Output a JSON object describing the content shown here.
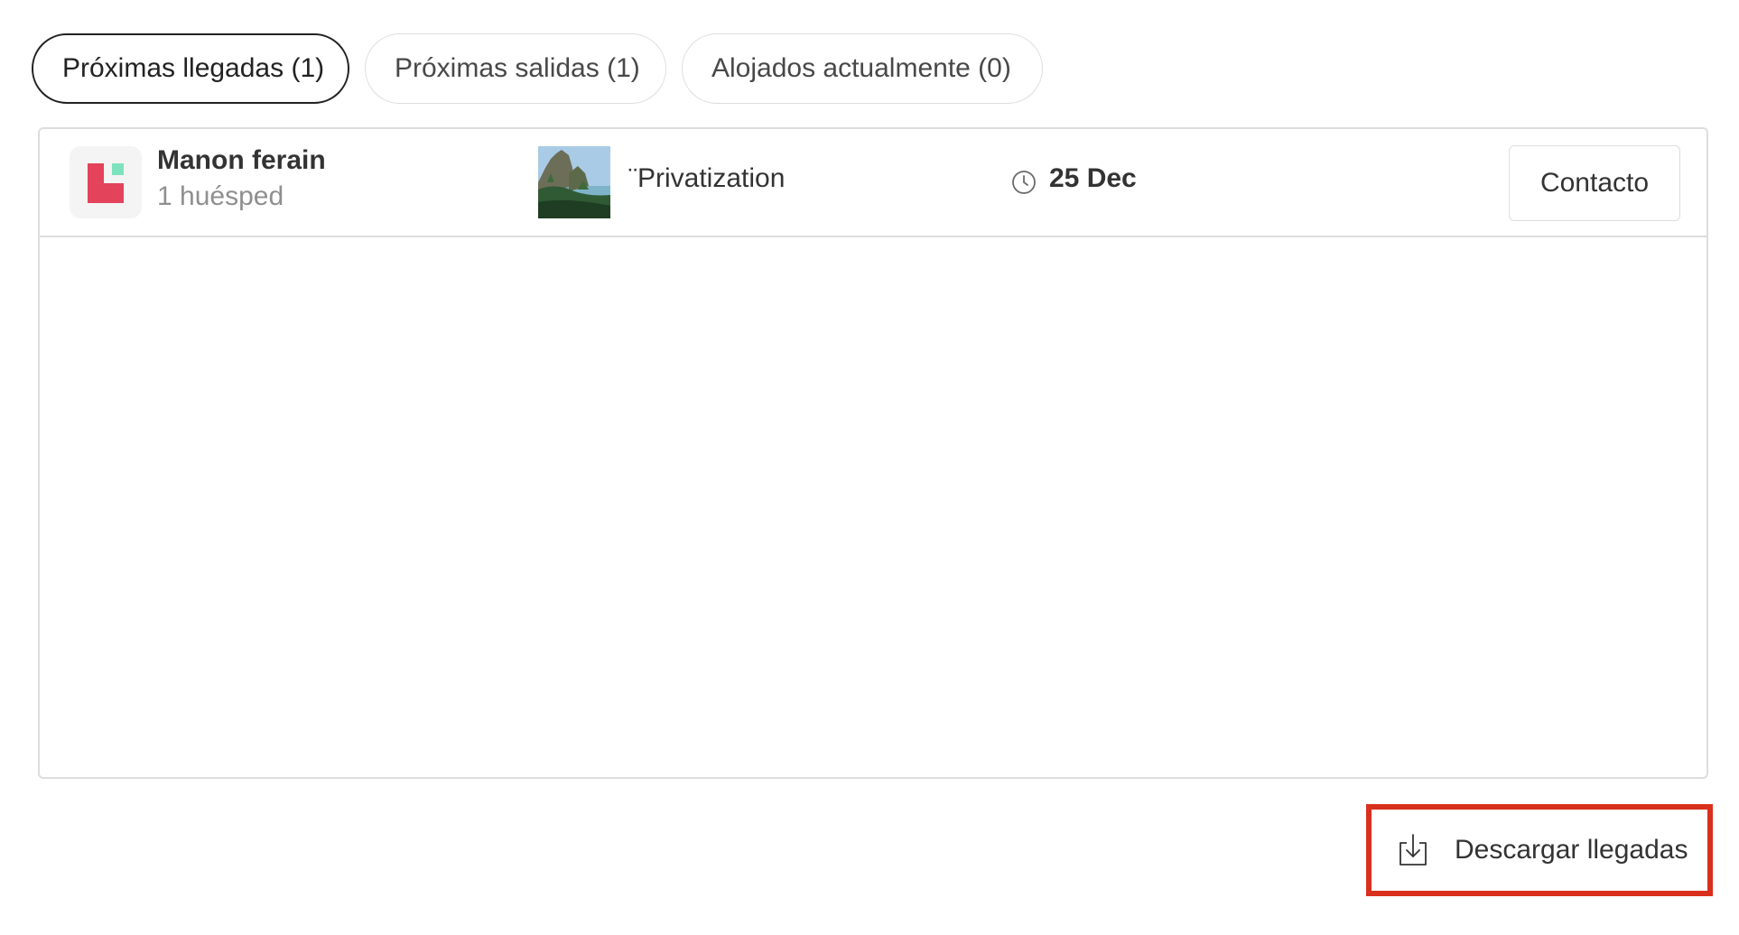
{
  "tabs": [
    {
      "label": "Próximas llegadas (1)",
      "active": true
    },
    {
      "label": "Próximas salidas (1)",
      "active": false
    },
    {
      "label": "Alojados actualmente (0)",
      "active": false
    }
  ],
  "arrivals": [
    {
      "guest_name": "Manon ferain",
      "guest_count": "1 huésped",
      "avatar_icon": "brand-logo-icon",
      "listing_name": "¨Privatization",
      "listing_thumb_icon": "listing-photo",
      "date_icon": "clock-icon",
      "date": "25 Dec",
      "contact_label": "Contacto"
    }
  ],
  "download": {
    "label": "Descargar llegadas",
    "icon": "download-icon"
  },
  "colors": {
    "brand_red": "#e3435b",
    "brand_green": "#7ee2bf",
    "highlight_red": "#d9301d",
    "border": "#dddddd",
    "active_tab_border": "#222222"
  }
}
